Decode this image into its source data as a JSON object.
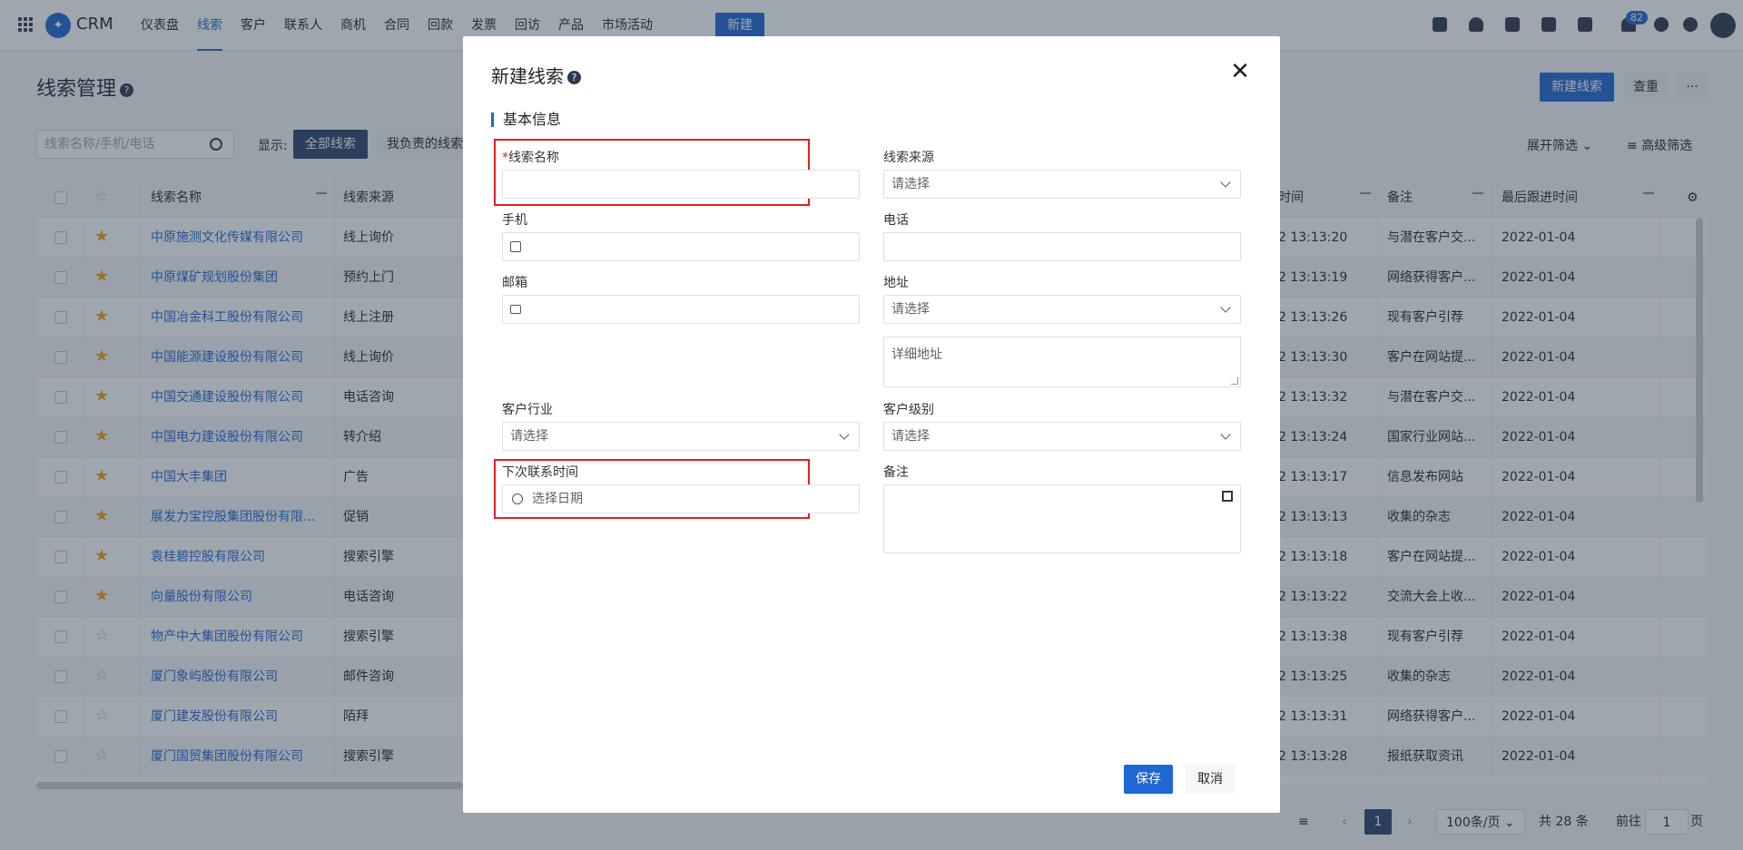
{
  "app": {
    "brand": "CRM"
  },
  "nav": {
    "items": [
      "仪表盘",
      "线索",
      "客户",
      "联系人",
      "商机",
      "合同",
      "回款",
      "发票",
      "回访",
      "产品",
      "市场活动"
    ],
    "active_index": 1,
    "new_label": "新建",
    "notification_count": "82"
  },
  "page": {
    "title": "线索管理",
    "new_lead_label": "新建线索",
    "dedupe_label": "查重",
    "more_label": "···"
  },
  "filters": {
    "search_placeholder": "线索名称/手机/电话",
    "show_label": "显示:",
    "all_leads": "全部线索",
    "my_leads": "我负责的线索",
    "expand_filter": "展开筛选",
    "advanced_filter": "高级筛选"
  },
  "table": {
    "headers": {
      "name": "线索名称",
      "source": "线索来源",
      "time": "时间",
      "remark": "备注",
      "last_follow": "最后跟进时间"
    },
    "rows": [
      {
        "name": "中原施测文化传媒有限公司",
        "source": "线上询价",
        "time": "2 13:13:20",
        "remark": "与潜在客户交...",
        "last": "2022-01-04",
        "star": true
      },
      {
        "name": "中原煤矿规划股份集团",
        "source": "预约上门",
        "time": "2 13:13:19",
        "remark": "网络获得客户...",
        "last": "2022-01-04",
        "star": true
      },
      {
        "name": "中国冶金科工股份有限公司",
        "source": "线上注册",
        "time": "2 13:13:26",
        "remark": "现有客户引荐",
        "last": "2022-01-04",
        "star": true
      },
      {
        "name": "中国能源建设股份有限公司",
        "source": "线上询价",
        "time": "2 13:13:30",
        "remark": "客户在网站提...",
        "last": "2022-01-04",
        "star": true
      },
      {
        "name": "中国交通建设股份有限公司",
        "source": "电话咨询",
        "time": "2 13:13:32",
        "remark": "与潜在客户交...",
        "last": "2022-01-04",
        "star": true
      },
      {
        "name": "中国电力建设股份有限公司",
        "source": "转介绍",
        "time": "2 13:13:24",
        "remark": "国家行业网站...",
        "last": "2022-01-04",
        "star": true
      },
      {
        "name": "中国大丰集团",
        "source": "广告",
        "time": "2 13:13:17",
        "remark": "信息发布网站",
        "last": "2022-01-04",
        "star": true
      },
      {
        "name": "展发力宝控股集团股份有限...",
        "source": "促销",
        "time": "2 13:13:13",
        "remark": "收集的杂志",
        "last": "2022-01-04",
        "star": true
      },
      {
        "name": "袁桂碧控股有限公司",
        "source": "搜索引擎",
        "time": "2 13:13:18",
        "remark": "客户在网站提...",
        "last": "2022-01-04",
        "star": true
      },
      {
        "name": "向量股份有限公司",
        "source": "电话咨询",
        "time": "2 13:13:22",
        "remark": "交流大会上收...",
        "last": "2022-01-04",
        "star": true
      },
      {
        "name": "物产中大集团股份有限公司",
        "source": "搜索引擎",
        "time": "2 13:13:38",
        "remark": "现有客户引荐",
        "last": "2022-01-04",
        "star": false
      },
      {
        "name": "厦门象屿股份有限公司",
        "source": "邮件咨询",
        "time": "2 13:13:25",
        "remark": "收集的杂志",
        "last": "2022-01-04",
        "star": false
      },
      {
        "name": "厦门建发股份有限公司",
        "source": "陌拜",
        "time": "2 13:13:31",
        "remark": "网络获得客户...",
        "last": "2022-01-04",
        "star": false
      },
      {
        "name": "厦门国贸集团股份有限公司",
        "source": "搜索引擎",
        "time": "2 13:13:28",
        "remark": "报纸获取资讯",
        "last": "2022-01-04",
        "star": false
      }
    ]
  },
  "pagination": {
    "current": "1",
    "per_page": "100条/页",
    "total": "共 28 条",
    "goto_label": "前往",
    "goto_value": "1",
    "page_suffix": "页"
  },
  "modal": {
    "title": "新建线索",
    "section": "基本信息",
    "fields": {
      "name_label": "线索名称",
      "name_required": "*",
      "source_label": "线索来源",
      "source_placeholder": "请选择",
      "mobile_label": "手机",
      "phone_label": "电话",
      "email_label": "邮箱",
      "address_label": "地址",
      "address_placeholder": "请选择",
      "address_detail_placeholder": "详细地址",
      "industry_label": "客户行业",
      "industry_placeholder": "请选择",
      "level_label": "客户级别",
      "level_placeholder": "请选择",
      "next_contact_label": "下次联系时间",
      "next_contact_placeholder": "选择日期",
      "remark_label": "备注"
    },
    "save_label": "保存",
    "cancel_label": "取消",
    "close_symbol": "✕"
  },
  "colors": {
    "primary": "#1f67d2",
    "highlight": "#e02020",
    "star": "#f2a50c"
  }
}
